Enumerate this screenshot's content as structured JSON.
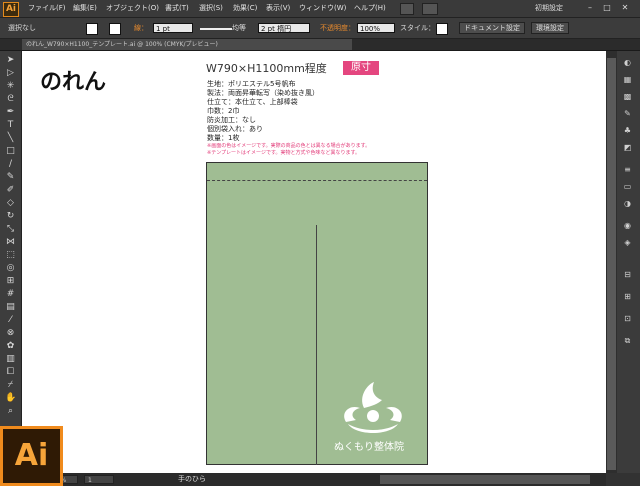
{
  "app": {
    "logo": "Ai",
    "workspace": "初期設定"
  },
  "menu": [
    "ファイル(F)",
    "編集(E)",
    "オブジェクト(O)",
    "書式(T)",
    "選択(S)",
    "効果(C)",
    "表示(V)",
    "ウィンドウ(W)",
    "ヘルプ(H)"
  ],
  "control_bar": {
    "selection": "選択なし",
    "stroke_label": "線：",
    "stroke_weight": "1 pt",
    "stroke_style": "均等",
    "brush": "2 pt 楕円",
    "opacity_label": "不透明度：",
    "opacity": "100%",
    "style_label": "スタイル：",
    "doc_settings": "ドキュメント設定",
    "prefs": "環境設定"
  },
  "document_tab": "のれん_W790×H1100_テンプレート.ai @ 100% (CMYK/プレビュー)",
  "artboard": {
    "title": "のれん",
    "size": "W790×H1100mm程度",
    "badge": "原寸",
    "specs": [
      "生地：ポリエステル5号帆布",
      "製法：両面昇華転写（染め抜き風）",
      "仕立て：本仕立て、上部棒袋",
      "巾数：2巾",
      "防炎加工：なし",
      "個別袋入れ：あり",
      "数量：1枚"
    ],
    "notes": [
      "※画面の色はイメージです。実際の商品の色とは異なる場合があります。",
      "※テンプレートはイメージです。実物と方式や色味など異なります。"
    ],
    "brand_name": "ぬくもり整体院"
  },
  "status": {
    "zoom": "100%",
    "page": "1",
    "tool": "手のひら"
  },
  "colors": {
    "accent": "#e4467f",
    "noren_green": "#a0bd93",
    "ai_orange": "#f08b1d"
  },
  "tools": [
    "selection-tool",
    "direct-selection-tool",
    "magic-wand-tool",
    "lasso-tool",
    "pen-tool",
    "type-tool",
    "line-tool",
    "rectangle-tool",
    "paintbrush-tool",
    "pencil-tool",
    "blob-brush-tool",
    "eraser-tool",
    "rotate-tool",
    "scale-tool",
    "width-tool",
    "free-transform-tool",
    "shape-builder-tool",
    "perspective-tool",
    "mesh-tool",
    "gradient-tool",
    "eyedropper-tool",
    "blend-tool",
    "symbol-sprayer-tool",
    "column-graph-tool",
    "artboard-tool",
    "slice-tool",
    "hand-tool",
    "zoom-tool"
  ],
  "dock": [
    "color-icon",
    "color-guide-icon",
    "swatches-icon",
    "brushes-icon",
    "symbols-icon",
    "graphic-styles-icon",
    "stroke-icon",
    "gradient-icon",
    "transparency-icon",
    "appearance-icon",
    "layers-icon",
    "artboards-icon",
    "align-icon",
    "transform-icon",
    "pathfinder-icon"
  ]
}
